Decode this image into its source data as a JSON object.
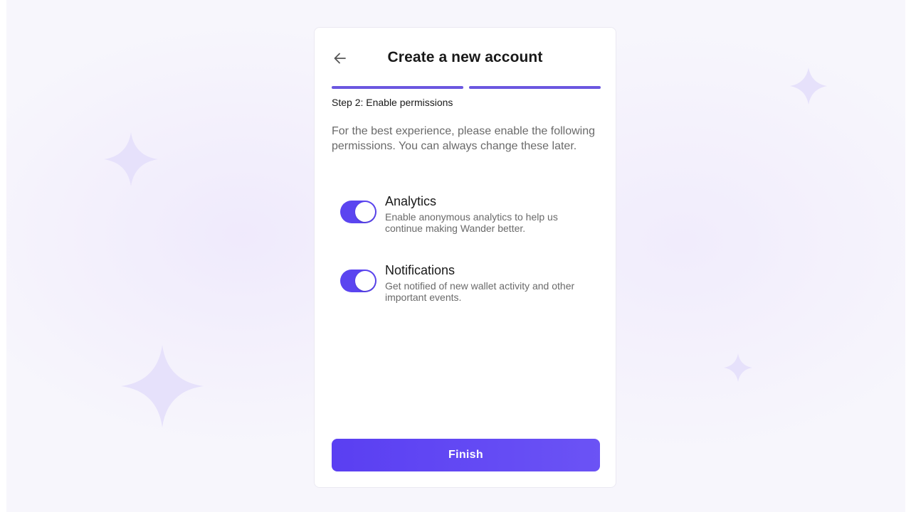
{
  "header": {
    "title": "Create a new account",
    "back_icon": "arrow-left-icon"
  },
  "progress": {
    "total_steps": 2,
    "completed_steps": 2
  },
  "step": {
    "label": "Step 2: Enable permissions"
  },
  "intro": {
    "text": "For the best experience, please enable the following permissions. You can always change these later."
  },
  "permissions": [
    {
      "title": "Analytics",
      "description": "Enable anonymous analytics to help us continue making Wander better.",
      "enabled": true
    },
    {
      "title": "Notifications",
      "description": "Get notified of new wallet activity and other important events.",
      "enabled": true
    }
  ],
  "actions": {
    "finish_label": "Finish"
  },
  "colors": {
    "accent": "#5b45f0",
    "progress": "#6b57e0",
    "background": "#f7f6fc",
    "sparkle": "#e6e1fb"
  },
  "decor": {
    "sparkle_icon": "four-point-star-icon"
  }
}
